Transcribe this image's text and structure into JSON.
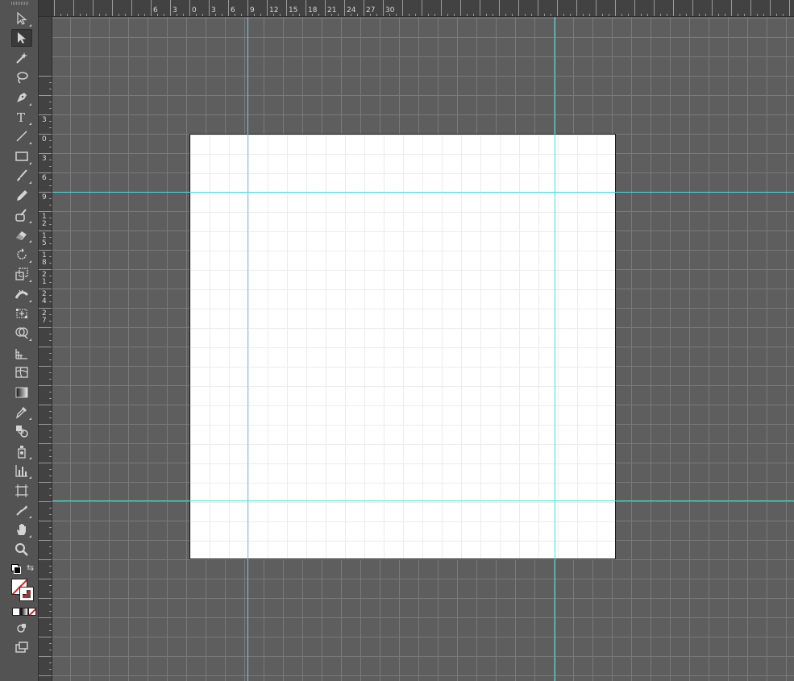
{
  "toolbar": {
    "tools": [
      {
        "name": "selection-tool",
        "icon": "selection-arrow-icon",
        "active": false
      },
      {
        "name": "direct-selection-tool",
        "icon": "direct-selection-arrow-icon",
        "active": true
      },
      {
        "name": "magic-wand-tool",
        "icon": "magic-wand-icon",
        "active": false
      },
      {
        "name": "lasso-tool",
        "icon": "lasso-icon",
        "active": false
      },
      {
        "name": "pen-tool",
        "icon": "pen-icon",
        "active": false
      },
      {
        "name": "type-tool",
        "icon": "type-icon",
        "active": false
      },
      {
        "name": "line-segment-tool",
        "icon": "line-icon",
        "active": false
      },
      {
        "name": "rectangle-tool",
        "icon": "rectangle-icon",
        "active": false
      },
      {
        "name": "paintbrush-tool",
        "icon": "paintbrush-icon",
        "active": false
      },
      {
        "name": "pencil-tool",
        "icon": "pencil-icon",
        "active": false
      },
      {
        "name": "blob-brush-tool",
        "icon": "blob-brush-icon",
        "active": false
      },
      {
        "name": "eraser-tool",
        "icon": "eraser-icon",
        "active": false
      },
      {
        "name": "rotate-tool",
        "icon": "rotate-icon",
        "active": false
      },
      {
        "name": "scale-tool",
        "icon": "scale-icon",
        "active": false
      },
      {
        "name": "width-tool",
        "icon": "width-icon",
        "active": false
      },
      {
        "name": "free-transform-tool",
        "icon": "free-transform-icon",
        "active": false
      },
      {
        "name": "shape-builder-tool",
        "icon": "shape-builder-icon",
        "active": false
      },
      {
        "name": "perspective-grid-tool",
        "icon": "perspective-grid-icon",
        "active": false
      },
      {
        "name": "mesh-tool",
        "icon": "mesh-icon",
        "active": false
      },
      {
        "name": "gradient-tool",
        "icon": "gradient-icon",
        "active": false
      },
      {
        "name": "eyedropper-tool",
        "icon": "eyedropper-icon",
        "active": false
      },
      {
        "name": "blend-tool",
        "icon": "blend-icon",
        "active": false
      },
      {
        "name": "symbol-sprayer-tool",
        "icon": "symbol-sprayer-icon",
        "active": false
      },
      {
        "name": "column-graph-tool",
        "icon": "column-graph-icon",
        "active": false
      },
      {
        "name": "artboard-tool",
        "icon": "artboard-icon",
        "active": false
      },
      {
        "name": "slice-tool",
        "icon": "slice-icon",
        "active": false
      },
      {
        "name": "hand-tool",
        "icon": "hand-icon",
        "active": false
      },
      {
        "name": "zoom-tool",
        "icon": "zoom-icon",
        "active": false
      }
    ],
    "fill_color": "#ffffff",
    "stroke_color": "none"
  },
  "ruler_top": {
    "labels": [
      "6",
      "3",
      "0",
      "3",
      "6",
      "9",
      "12",
      "15",
      "18",
      "21",
      "24",
      "27",
      "30"
    ]
  },
  "ruler_left": {
    "labels": [
      "3",
      "0",
      "3",
      "6",
      "9",
      "12",
      "15",
      "18",
      "21",
      "24",
      "27"
    ]
  },
  "colors": {
    "canvas_bg": "#5e5e5e",
    "grid_line": "#7a7a7a",
    "guide": "#3fe0ef",
    "artboard": "#ffffff",
    "ruler_bg": "#424242"
  }
}
